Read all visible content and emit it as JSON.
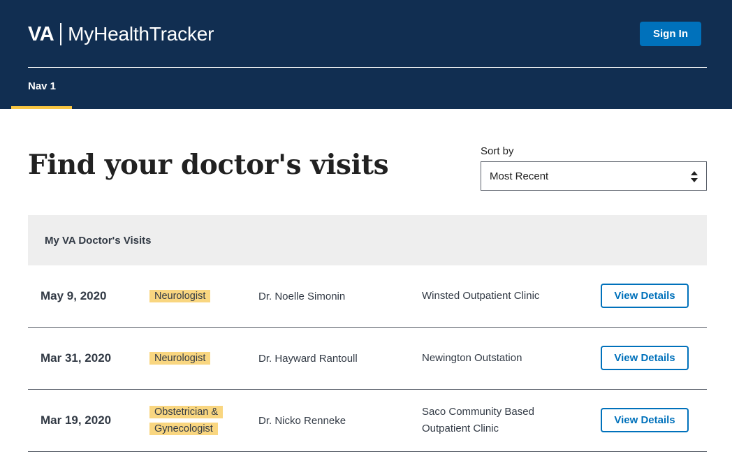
{
  "header": {
    "brand_va": "VA",
    "brand_name": "MyHealthTracker",
    "signin_label": "Sign In",
    "nav": [
      {
        "label": "Nav 1",
        "active": true
      }
    ]
  },
  "main": {
    "title": "Find your doctor's visits",
    "sort": {
      "label": "Sort by",
      "selected": "Most Recent"
    },
    "table": {
      "heading": "My VA Doctor's Visits",
      "button_label": "View Details",
      "rows": [
        {
          "date": "May 9, 2020",
          "specialty": "Neurologist",
          "doctor": "Dr. Noelle Simonin",
          "location": "Winsted Outpatient Clinic"
        },
        {
          "date": "Mar 31, 2020",
          "specialty": "Neurologist",
          "doctor": "Dr. Hayward Rantoull",
          "location": "Newington Outstation"
        },
        {
          "date": "Mar 19, 2020",
          "specialty": "Obstetrician & Gynecologist",
          "doctor": "Dr. Nicko Renneke",
          "location": "Saco Community Based Outpatient Clinic"
        }
      ]
    }
  },
  "colors": {
    "header_bg": "#112e51",
    "accent_blue": "#0071bb",
    "active_underline": "#f9c642",
    "tag_bg": "#f9d680",
    "table_head_bg": "#eeeeee"
  }
}
